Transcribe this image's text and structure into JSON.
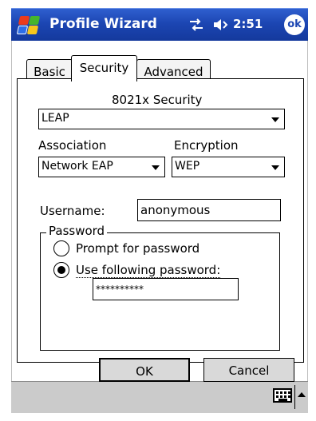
{
  "titlebar": {
    "title": "Profile Wizard",
    "time": "2:51",
    "ok_label": "ok",
    "colors": {
      "bar": "#1c46b3",
      "text": "#ffffff"
    },
    "icons": [
      "windows-start-icon",
      "connectivity-icon",
      "volume-icon",
      "ok-close-icon"
    ]
  },
  "tabs": [
    {
      "label": "Basic",
      "active": false
    },
    {
      "label": "Security",
      "active": true
    },
    {
      "label": "Advanced",
      "active": false
    }
  ],
  "security": {
    "section_label": "8021x Security",
    "security_value": "LEAP",
    "association_label": "Association",
    "association_value": "Network EAP",
    "encryption_label": "Encryption",
    "encryption_value": "WEP",
    "username_label": "Username:",
    "username_value": "anonymous",
    "password_group_label": "Password",
    "prompt_option": "Prompt for password",
    "use_following_option": "Use following password:",
    "password_value": "**********",
    "selected_option": "use_following"
  },
  "buttons": {
    "ok": "OK",
    "cancel": "Cancel"
  },
  "menubar": {
    "icons": [
      "keyboard-icon",
      "sip-up-arrow-icon"
    ]
  }
}
